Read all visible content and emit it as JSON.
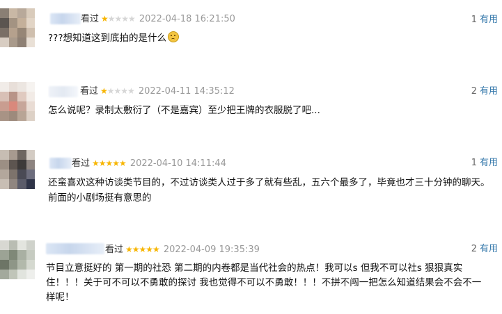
{
  "reviews": [
    {
      "watched": "看过",
      "rating": 1,
      "time": "2022-04-18 16:21:50",
      "useful_count": "1",
      "useful_label": "有用",
      "content": "???想知道这到底拍的是什么",
      "emoji": "sad-face"
    },
    {
      "watched": "看过",
      "rating": 1,
      "time": "2022-04-11 14:35:12",
      "useful_count": "2",
      "useful_label": "有用",
      "content": "怎么说呢？录制太敷衍了（不是嘉宾）至少把王牌的衣服脱了吧..."
    },
    {
      "watched": "看过",
      "rating": 5,
      "time": "2022-04-10 14:11:44",
      "useful_count": "1",
      "useful_label": "有用",
      "content_lines": [
        "还蛮喜欢这种访谈类节目的，不过访谈类人过于多了就有些乱，五六个最多了，毕竟也才三十分钟的聊天。",
        "前面的小剧场挺有意思的"
      ]
    },
    {
      "watched": "看过",
      "rating": 5,
      "time": "2022-04-09 19:35:39",
      "useful_count": "2",
      "useful_label": "有用",
      "content_lines": [
        "节目立意挺好的 第一期的社恐 第二期的内卷都是当代社会的热点！我可以s 但我不可以社s 狠狠真实",
        "住！！！关于可不可以不勇敢的探讨 我也觉得不可以不勇敢！！！不拼不闯一把怎么知道结果会不会不一",
        "样呢！"
      ]
    }
  ],
  "colors": {
    "star": "#f7b500",
    "star_empty": "#d6d6d6",
    "link": "#3377aa",
    "time": "#999999"
  }
}
